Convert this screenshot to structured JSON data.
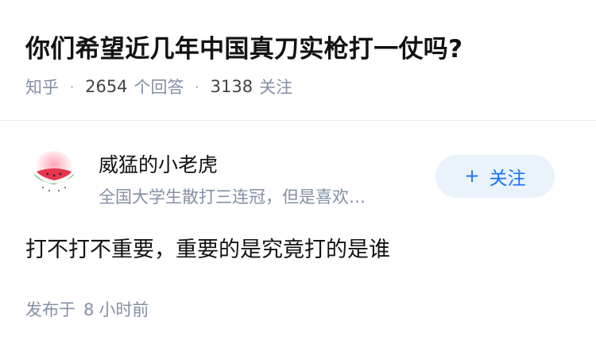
{
  "question": {
    "title": "你们希望近几年中国真刀实枪打一仗吗?",
    "source": "知乎",
    "separator": "·",
    "answer_count": "2654",
    "answer_label": "个回答",
    "follower_count": "3138",
    "follower_label": "关注"
  },
  "answer": {
    "author": {
      "name": "威猛的小老虎",
      "bio": "全国大学生散打三连冠，但是喜欢…",
      "avatar_icon": "watermelon-slice-icon"
    },
    "follow_button": {
      "icon": "+",
      "label": "关注"
    },
    "content": "打不打不重要，重要的是究竟打的是谁",
    "time_prefix": "发布于",
    "time_number": "8",
    "time_suffix": "小时前"
  },
  "colors": {
    "title": "#121212",
    "meta": "#8590a6",
    "follow_bg": "#eaf2fc",
    "follow_text": "#1772f6",
    "divider": "#ececec"
  }
}
